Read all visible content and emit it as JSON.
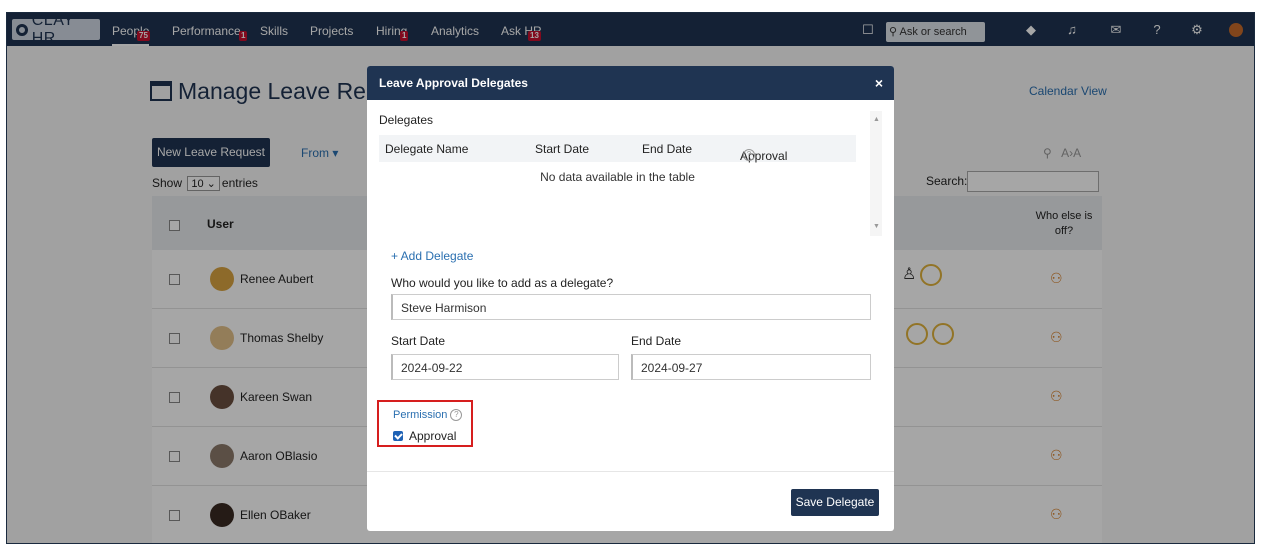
{
  "nav": {
    "logo_text": "CLAY HR",
    "items": [
      {
        "label": "People",
        "badge": "75"
      },
      {
        "label": "Performance",
        "badge": "1"
      },
      {
        "label": "Skills",
        "badge": ""
      },
      {
        "label": "Projects",
        "badge": ""
      },
      {
        "label": "Hiring",
        "badge": "1"
      },
      {
        "label": "Analytics",
        "badge": ""
      },
      {
        "label": "Ask HR",
        "badge": "13"
      }
    ],
    "search_placeholder": "Ask or search"
  },
  "page": {
    "title": "Manage Leave Re",
    "calendar_view": "Calendar View",
    "new_request": "New Leave Request",
    "from": "From ▾",
    "show": "Show",
    "entries_value": "10",
    "entries": "entries",
    "search_label": "Search:",
    "col_user": "User",
    "col_who_else": "Who else is off?",
    "rows": [
      {
        "name": "Renee Aubert"
      },
      {
        "name": "Thomas Shelby"
      },
      {
        "name": "Kareen Swan"
      },
      {
        "name": "Aaron OBlasio"
      },
      {
        "name": "Ellen OBaker"
      }
    ]
  },
  "modal": {
    "title": "Leave Approval Delegates",
    "close": "×",
    "delegates_title": "Delegates",
    "col_name": "Delegate Name",
    "col_start": "Start Date",
    "col_end": "End Date",
    "col_approval": "Approval",
    "empty": "No data available in the table",
    "add_delegate": "+ Add Delegate",
    "question": "Who would you like to add as a delegate?",
    "delegate_value": "Steve Harmison",
    "start_label": "Start Date",
    "start_value": "2024-09-22",
    "end_label": "End Date",
    "end_value": "2024-09-27",
    "permission_label": "Permission",
    "approval_label": "Approval",
    "save": "Save Delegate"
  }
}
